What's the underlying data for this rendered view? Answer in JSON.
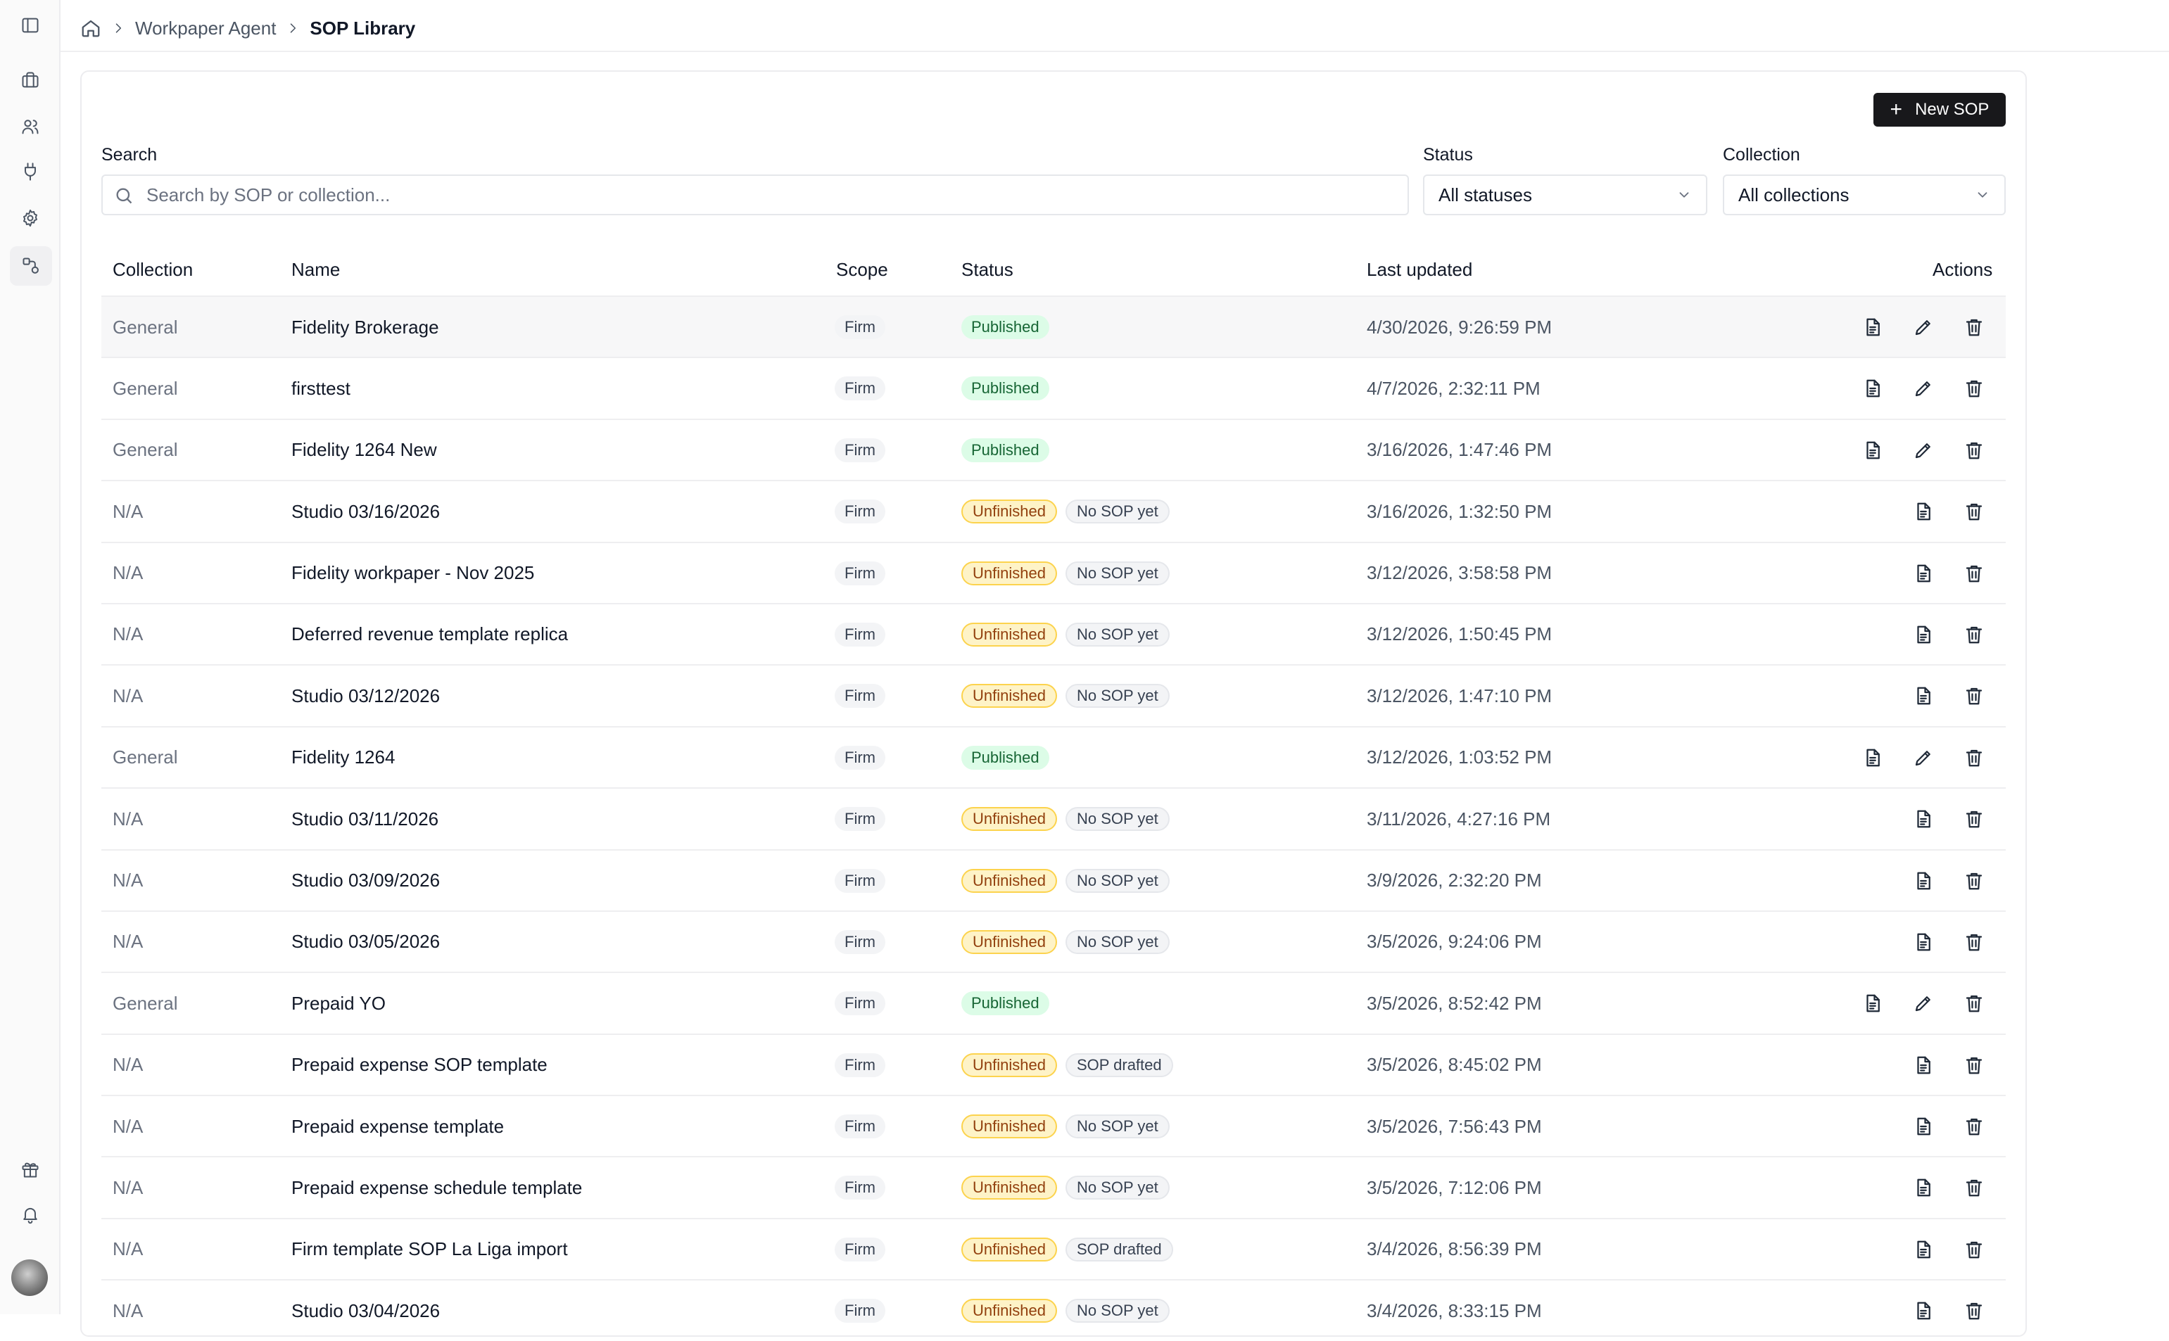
{
  "breadcrumb": {
    "home_icon": "home-icon",
    "parent": "Workpaper Agent",
    "current": "SOP Library"
  },
  "toolbar": {
    "new_label": "New SOP"
  },
  "filters": {
    "search_label": "Search",
    "search_placeholder": "Search by SOP or collection...",
    "status_label": "Status",
    "status_value": "All statuses",
    "collection_label": "Collection",
    "collection_value": "All collections"
  },
  "table": {
    "headers": {
      "collection": "Collection",
      "name": "Name",
      "scope": "Scope",
      "status": "Status",
      "last_updated": "Last updated",
      "actions": "Actions"
    },
    "rows": [
      {
        "collection": "General",
        "name": "Fidelity Brokerage",
        "scope": "Firm",
        "status": "Published",
        "sop_state": "",
        "updated": "4/30/2026, 9:26:59 PM"
      },
      {
        "collection": "General",
        "name": "firsttest",
        "scope": "Firm",
        "status": "Published",
        "sop_state": "",
        "updated": "4/7/2026, 2:32:11 PM"
      },
      {
        "collection": "General",
        "name": "Fidelity 1264 New",
        "scope": "Firm",
        "status": "Published",
        "sop_state": "",
        "updated": "3/16/2026, 1:47:46 PM"
      },
      {
        "collection": "N/A",
        "name": "Studio 03/16/2026",
        "scope": "Firm",
        "status": "Unfinished",
        "sop_state": "No SOP yet",
        "updated": "3/16/2026, 1:32:50 PM"
      },
      {
        "collection": "N/A",
        "name": "Fidelity workpaper - Nov 2025",
        "scope": "Firm",
        "status": "Unfinished",
        "sop_state": "No SOP yet",
        "updated": "3/12/2026, 3:58:58 PM"
      },
      {
        "collection": "N/A",
        "name": "Deferred revenue template replica",
        "scope": "Firm",
        "status": "Unfinished",
        "sop_state": "No SOP yet",
        "updated": "3/12/2026, 1:50:45 PM"
      },
      {
        "collection": "N/A",
        "name": "Studio 03/12/2026",
        "scope": "Firm",
        "status": "Unfinished",
        "sop_state": "No SOP yet",
        "updated": "3/12/2026, 1:47:10 PM"
      },
      {
        "collection": "General",
        "name": "Fidelity 1264",
        "scope": "Firm",
        "status": "Published",
        "sop_state": "",
        "updated": "3/12/2026, 1:03:52 PM"
      },
      {
        "collection": "N/A",
        "name": "Studio 03/11/2026",
        "scope": "Firm",
        "status": "Unfinished",
        "sop_state": "No SOP yet",
        "updated": "3/11/2026, 4:27:16 PM"
      },
      {
        "collection": "N/A",
        "name": "Studio 03/09/2026",
        "scope": "Firm",
        "status": "Unfinished",
        "sop_state": "No SOP yet",
        "updated": "3/9/2026, 2:32:20 PM"
      },
      {
        "collection": "N/A",
        "name": "Studio 03/05/2026",
        "scope": "Firm",
        "status": "Unfinished",
        "sop_state": "No SOP yet",
        "updated": "3/5/2026, 9:24:06 PM"
      },
      {
        "collection": "General",
        "name": "Prepaid YO",
        "scope": "Firm",
        "status": "Published",
        "sop_state": "",
        "updated": "3/5/2026, 8:52:42 PM"
      },
      {
        "collection": "N/A",
        "name": "Prepaid expense SOP template",
        "scope": "Firm",
        "status": "Unfinished",
        "sop_state": "SOP drafted",
        "updated": "3/5/2026, 8:45:02 PM"
      },
      {
        "collection": "N/A",
        "name": "Prepaid expense template",
        "scope": "Firm",
        "status": "Unfinished",
        "sop_state": "No SOP yet",
        "updated": "3/5/2026, 7:56:43 PM"
      },
      {
        "collection": "N/A",
        "name": "Prepaid expense schedule template",
        "scope": "Firm",
        "status": "Unfinished",
        "sop_state": "No SOP yet",
        "updated": "3/5/2026, 7:12:06 PM"
      },
      {
        "collection": "N/A",
        "name": "Firm template SOP La Liga import",
        "scope": "Firm",
        "status": "Unfinished",
        "sop_state": "SOP drafted",
        "updated": "3/4/2026, 8:56:39 PM"
      },
      {
        "collection": "N/A",
        "name": "Studio 03/04/2026",
        "scope": "Firm",
        "status": "Unfinished",
        "sop_state": "No SOP yet",
        "updated": "3/4/2026, 8:33:15 PM"
      }
    ]
  },
  "colors": {
    "published_bg": "#dcfce7",
    "published_text": "#166534",
    "unfinished_bg": "#fef3c7",
    "unfinished_text": "#92400e",
    "primary_button": "#18181b"
  }
}
